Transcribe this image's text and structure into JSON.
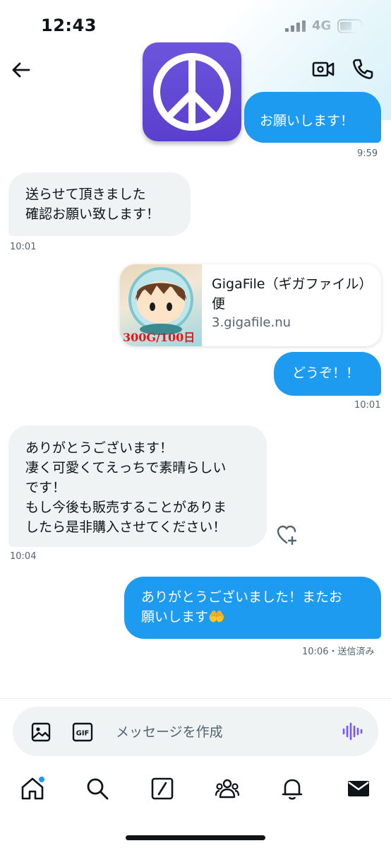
{
  "status_bar": {
    "time": "12:43",
    "network": "4G"
  },
  "header": {
    "app_icon": "peace-symbol-icon"
  },
  "messages": [
    {
      "side": "out",
      "text": "お願いします！",
      "time": "9:59"
    },
    {
      "side": "in",
      "text": "送らせて頂きました\n確認お願い致します！",
      "time": "10:01"
    },
    {
      "side": "out",
      "type": "link",
      "title": "GigaFile（ギガファイル）便",
      "domain": "3.gigafile.nu",
      "thumb_text": "300G/100日"
    },
    {
      "side": "out",
      "text": "どうぞ！！",
      "time": "10:01"
    },
    {
      "side": "in",
      "text": "ありがとうございます！\n凄く可愛くてえっちで素晴らしい\nです！\nもし今後も販売することがありま\nしたら是非購入させてください！",
      "time": "10:04"
    },
    {
      "side": "out",
      "text": "ありがとうございました！またお\n願いします🤲",
      "time": "10:06",
      "status": "・送信済み"
    }
  ],
  "composer": {
    "placeholder": "メッセージを作成",
    "gif_label": "GIF"
  },
  "nav": [
    "home-icon",
    "search-icon",
    "compose-icon",
    "communities-icon",
    "notifications-icon",
    "messages-icon"
  ],
  "colors": {
    "accent": "#1d9bf0",
    "incoming": "#eff3f4",
    "voice": "#7856ff",
    "app_icon": "#5b41cf"
  }
}
